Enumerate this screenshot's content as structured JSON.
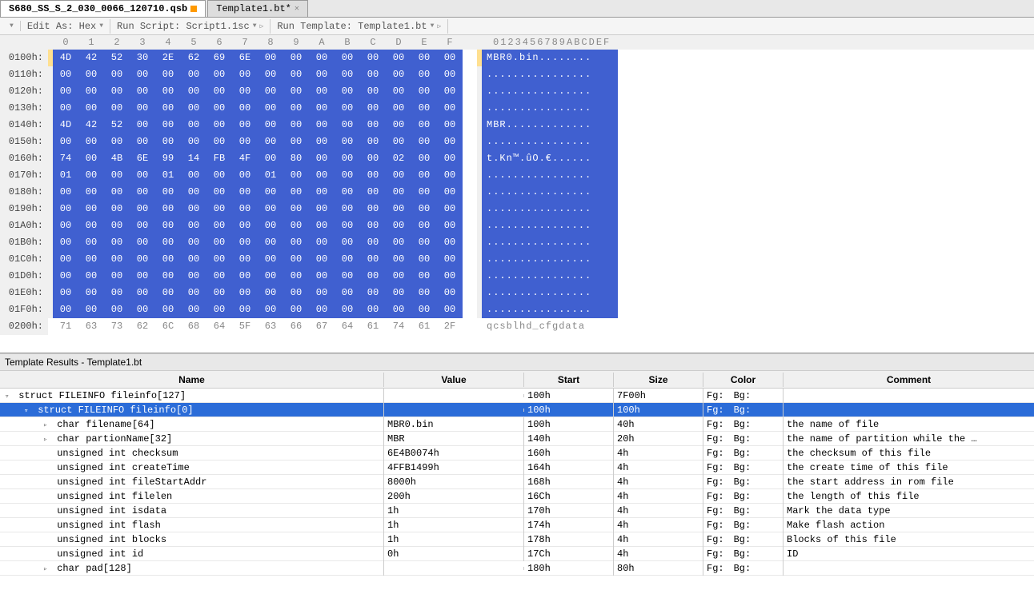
{
  "tabs": [
    {
      "label": "S680_SS_S_2_030_0066_120710.qsb",
      "active": true,
      "hasOrange": true
    },
    {
      "label": "Template1.bt*",
      "active": false,
      "hasClose": true
    }
  ],
  "toolbar": {
    "editAs": "Edit As: Hex",
    "runScript": "Run Script: Script1.1sc",
    "runTemplate": "Run Template: Template1.bt"
  },
  "hex": {
    "cols": [
      "0",
      "1",
      "2",
      "3",
      "4",
      "5",
      "6",
      "7",
      "8",
      "9",
      "A",
      "B",
      "C",
      "D",
      "E",
      "F"
    ],
    "asciiHeader": "0123456789ABCDEF",
    "rows": [
      {
        "off": "0100h:",
        "b": [
          "4D",
          "42",
          "52",
          "30",
          "2E",
          "62",
          "69",
          "6E",
          "00",
          "00",
          "00",
          "00",
          "00",
          "00",
          "00",
          "00"
        ],
        "a": "MBR0.bin........",
        "g": true
      },
      {
        "off": "0110h:",
        "b": [
          "00",
          "00",
          "00",
          "00",
          "00",
          "00",
          "00",
          "00",
          "00",
          "00",
          "00",
          "00",
          "00",
          "00",
          "00",
          "00"
        ],
        "a": "................"
      },
      {
        "off": "0120h:",
        "b": [
          "00",
          "00",
          "00",
          "00",
          "00",
          "00",
          "00",
          "00",
          "00",
          "00",
          "00",
          "00",
          "00",
          "00",
          "00",
          "00"
        ],
        "a": "................"
      },
      {
        "off": "0130h:",
        "b": [
          "00",
          "00",
          "00",
          "00",
          "00",
          "00",
          "00",
          "00",
          "00",
          "00",
          "00",
          "00",
          "00",
          "00",
          "00",
          "00"
        ],
        "a": "................"
      },
      {
        "off": "0140h:",
        "b": [
          "4D",
          "42",
          "52",
          "00",
          "00",
          "00",
          "00",
          "00",
          "00",
          "00",
          "00",
          "00",
          "00",
          "00",
          "00",
          "00"
        ],
        "a": "MBR............."
      },
      {
        "off": "0150h:",
        "b": [
          "00",
          "00",
          "00",
          "00",
          "00",
          "00",
          "00",
          "00",
          "00",
          "00",
          "00",
          "00",
          "00",
          "00",
          "00",
          "00"
        ],
        "a": "................"
      },
      {
        "off": "0160h:",
        "b": [
          "74",
          "00",
          "4B",
          "6E",
          "99",
          "14",
          "FB",
          "4F",
          "00",
          "80",
          "00",
          "00",
          "00",
          "02",
          "00",
          "00"
        ],
        "a": "t.Kn™.ûO.€......"
      },
      {
        "off": "0170h:",
        "b": [
          "01",
          "00",
          "00",
          "00",
          "01",
          "00",
          "00",
          "00",
          "01",
          "00",
          "00",
          "00",
          "00",
          "00",
          "00",
          "00"
        ],
        "a": "................"
      },
      {
        "off": "0180h:",
        "b": [
          "00",
          "00",
          "00",
          "00",
          "00",
          "00",
          "00",
          "00",
          "00",
          "00",
          "00",
          "00",
          "00",
          "00",
          "00",
          "00"
        ],
        "a": "................"
      },
      {
        "off": "0190h:",
        "b": [
          "00",
          "00",
          "00",
          "00",
          "00",
          "00",
          "00",
          "00",
          "00",
          "00",
          "00",
          "00",
          "00",
          "00",
          "00",
          "00"
        ],
        "a": "................"
      },
      {
        "off": "01A0h:",
        "b": [
          "00",
          "00",
          "00",
          "00",
          "00",
          "00",
          "00",
          "00",
          "00",
          "00",
          "00",
          "00",
          "00",
          "00",
          "00",
          "00"
        ],
        "a": "................"
      },
      {
        "off": "01B0h:",
        "b": [
          "00",
          "00",
          "00",
          "00",
          "00",
          "00",
          "00",
          "00",
          "00",
          "00",
          "00",
          "00",
          "00",
          "00",
          "00",
          "00"
        ],
        "a": "................"
      },
      {
        "off": "01C0h:",
        "b": [
          "00",
          "00",
          "00",
          "00",
          "00",
          "00",
          "00",
          "00",
          "00",
          "00",
          "00",
          "00",
          "00",
          "00",
          "00",
          "00"
        ],
        "a": "................"
      },
      {
        "off": "01D0h:",
        "b": [
          "00",
          "00",
          "00",
          "00",
          "00",
          "00",
          "00",
          "00",
          "00",
          "00",
          "00",
          "00",
          "00",
          "00",
          "00",
          "00"
        ],
        "a": "................"
      },
      {
        "off": "01E0h:",
        "b": [
          "00",
          "00",
          "00",
          "00",
          "00",
          "00",
          "00",
          "00",
          "00",
          "00",
          "00",
          "00",
          "00",
          "00",
          "00",
          "00"
        ],
        "a": "................"
      },
      {
        "off": "01F0h:",
        "b": [
          "00",
          "00",
          "00",
          "00",
          "00",
          "00",
          "00",
          "00",
          "00",
          "00",
          "00",
          "00",
          "00",
          "00",
          "00",
          "00"
        ],
        "a": "................"
      },
      {
        "off": "0200h:",
        "b": [
          "71",
          "63",
          "73",
          "62",
          "6C",
          "68",
          "64",
          "5F",
          "63",
          "66",
          "67",
          "64",
          "61",
          "74",
          "61",
          "2F"
        ],
        "a": "qcsblhd_cfgdata",
        "faded": true
      }
    ]
  },
  "resultsTitle": "Template Results - Template1.bt",
  "resultsHeader": {
    "name": "Name",
    "value": "Value",
    "start": "Start",
    "size": "Size",
    "color": "Color",
    "comment": "Comment"
  },
  "resultsRows": [
    {
      "indent": 0,
      "arrow": "▿",
      "name": "struct FILEINFO fileinfo[127]",
      "value": "",
      "start": "100h",
      "size": "7F00h",
      "fg": "Fg:",
      "bg": "Bg:",
      "comment": ""
    },
    {
      "indent": 1,
      "arrow": "▿",
      "name": "struct FILEINFO fileinfo[0]",
      "value": "",
      "start": "100h",
      "size": "100h",
      "fg": "Fg:",
      "bg": "Bg:",
      "comment": "",
      "selected": true
    },
    {
      "indent": 2,
      "arrow": "▹",
      "name": "char filename[64]",
      "value": "MBR0.bin",
      "start": "100h",
      "size": "40h",
      "fg": "Fg:",
      "bg": "Bg:",
      "comment": "the name of file"
    },
    {
      "indent": 2,
      "arrow": "▹",
      "name": "char partionName[32]",
      "value": "MBR",
      "start": "140h",
      "size": "20h",
      "fg": "Fg:",
      "bg": "Bg:",
      "comment": "the name of partition while the …"
    },
    {
      "indent": 2,
      "arrow": "",
      "name": "unsigned int checksum",
      "value": "6E4B0074h",
      "start": "160h",
      "size": "4h",
      "fg": "Fg:",
      "bg": "Bg:",
      "comment": "the checksum of this file"
    },
    {
      "indent": 2,
      "arrow": "",
      "name": "unsigned int createTime",
      "value": "4FFB1499h",
      "start": "164h",
      "size": "4h",
      "fg": "Fg:",
      "bg": "Bg:",
      "comment": "the create time of this file"
    },
    {
      "indent": 2,
      "arrow": "",
      "name": "unsigned int fileStartAddr",
      "value": "8000h",
      "start": "168h",
      "size": "4h",
      "fg": "Fg:",
      "bg": "Bg:",
      "comment": "the start address in rom file"
    },
    {
      "indent": 2,
      "arrow": "",
      "name": "unsigned int filelen",
      "value": "200h",
      "start": "16Ch",
      "size": "4h",
      "fg": "Fg:",
      "bg": "Bg:",
      "comment": "the length of this file"
    },
    {
      "indent": 2,
      "arrow": "",
      "name": "unsigned int isdata",
      "value": "1h",
      "start": "170h",
      "size": "4h",
      "fg": "Fg:",
      "bg": "Bg:",
      "comment": "Mark the data type"
    },
    {
      "indent": 2,
      "arrow": "",
      "name": "unsigned int flash",
      "value": "1h",
      "start": "174h",
      "size": "4h",
      "fg": "Fg:",
      "bg": "Bg:",
      "comment": "Make flash action"
    },
    {
      "indent": 2,
      "arrow": "",
      "name": "unsigned int blocks",
      "value": "1h",
      "start": "178h",
      "size": "4h",
      "fg": "Fg:",
      "bg": "Bg:",
      "comment": "Blocks of this file"
    },
    {
      "indent": 2,
      "arrow": "",
      "name": "unsigned int id",
      "value": "0h",
      "start": "17Ch",
      "size": "4h",
      "fg": "Fg:",
      "bg": "Bg:",
      "comment": "ID"
    },
    {
      "indent": 2,
      "arrow": "▹",
      "name": "char pad[128]",
      "value": "",
      "start": "180h",
      "size": "80h",
      "fg": "Fg:",
      "bg": "Bg:",
      "comment": ""
    }
  ]
}
